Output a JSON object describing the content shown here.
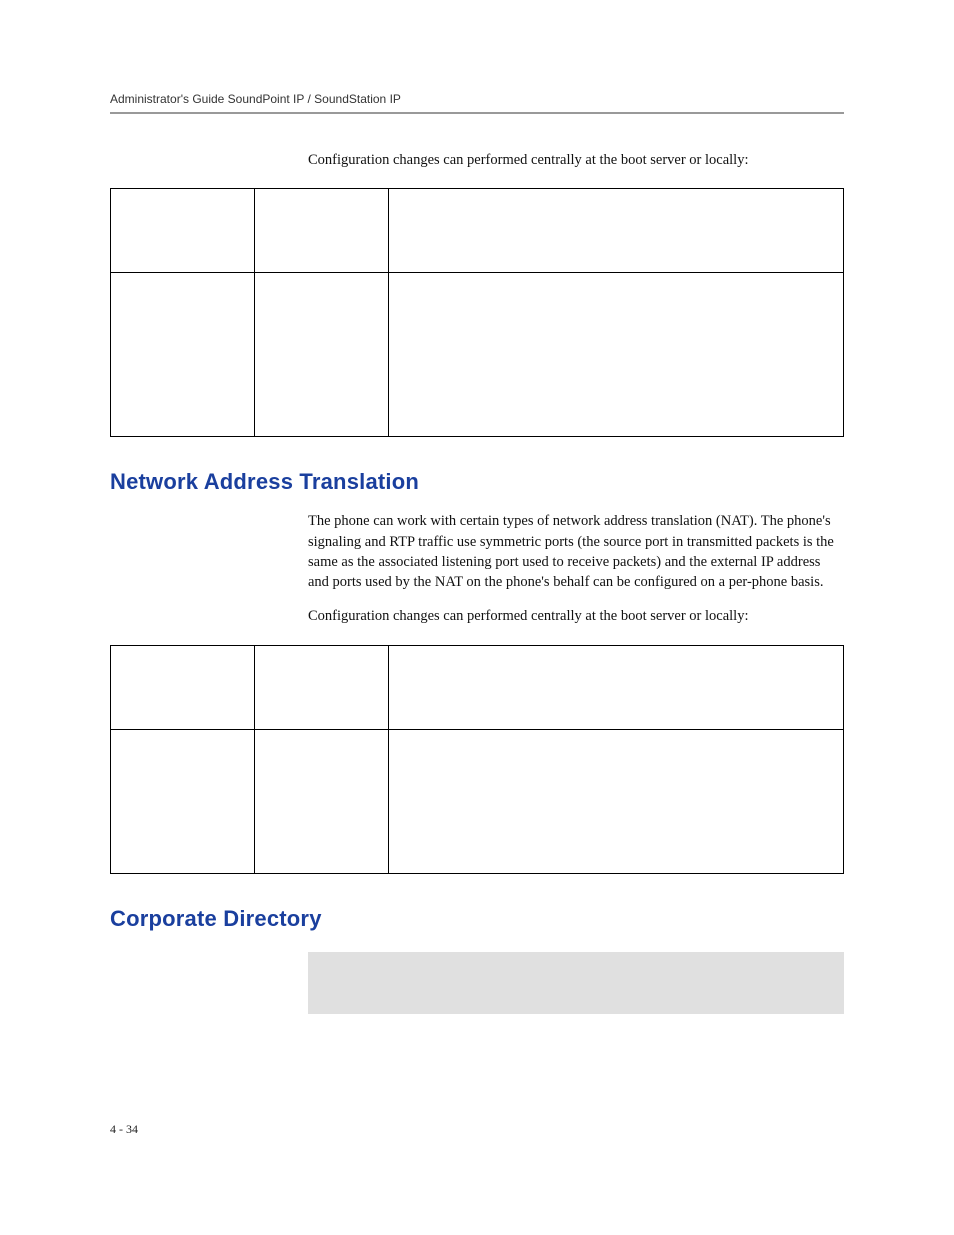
{
  "header": {
    "running_title": "Administrator's Guide SoundPoint IP / SoundStation IP"
  },
  "para1": "Configuration changes can performed centrally at the boot server or locally:",
  "table1": {
    "rows": [
      [
        {
          "text": ""
        },
        {
          "text": ""
        },
        {
          "text": ""
        }
      ],
      [
        {
          "text": ""
        },
        {
          "text": ""
        },
        {
          "text": ""
        }
      ]
    ]
  },
  "section1": {
    "heading": "Network Address Translation",
    "body1": "The phone can work with certain types of network address translation (NAT). The phone's signaling and RTP traffic use symmetric ports (the source port in transmitted packets is the same as the associated listening port used to receive packets) and the external IP address and ports used by the NAT on the phone's behalf can be configured on a per-phone basis.",
    "body2": "Configuration changes can performed centrally at the boot server or locally:"
  },
  "table2": {
    "rows": [
      [
        {
          "text": ""
        },
        {
          "text": ""
        },
        {
          "text": ""
        }
      ],
      [
        {
          "text": ""
        },
        {
          "text": ""
        },
        {
          "text": ""
        }
      ]
    ]
  },
  "section2": {
    "heading": "Corporate Directory"
  },
  "footer": {
    "page_number": "4 - 34"
  }
}
